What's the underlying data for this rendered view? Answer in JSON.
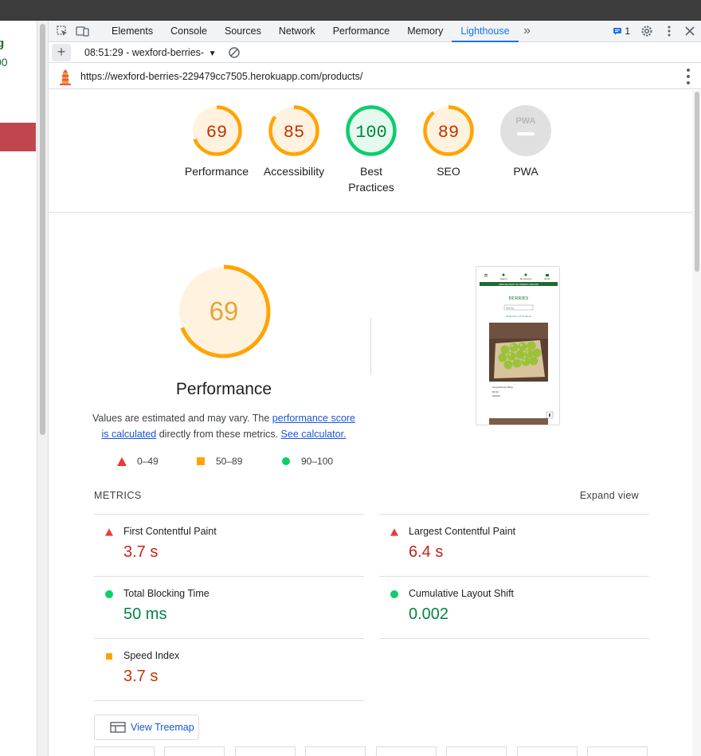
{
  "left_page": {
    "fragment_1": "g",
    "fragment_2": "00"
  },
  "tabs": [
    {
      "label": "Elements"
    },
    {
      "label": "Console"
    },
    {
      "label": "Sources"
    },
    {
      "label": "Network"
    },
    {
      "label": "Performance"
    },
    {
      "label": "Memory"
    },
    {
      "label": "Lighthouse",
      "active": true
    }
  ],
  "issues_count": "1",
  "report": {
    "selector": "08:51:29 - wexford-berries-",
    "url": "https://wexford-berries-229479cc7505.herokuapp.com/products/"
  },
  "scores": [
    {
      "label": "Performance",
      "score": "69",
      "fraction": 0.69,
      "rating": "average"
    },
    {
      "label": "Accessibility",
      "score": "85",
      "fraction": 0.85,
      "rating": "average"
    },
    {
      "label_line1": "Best",
      "label_line2": "Practices",
      "score": "100",
      "fraction": 1.0,
      "rating": "pass"
    },
    {
      "label": "SEO",
      "score": "89",
      "fraction": 0.89,
      "rating": "average"
    },
    {
      "label": "PWA",
      "badge": "PWA"
    }
  ],
  "performance": {
    "score": "69",
    "fraction": 0.69,
    "title": "Performance",
    "desc_1": "Values are estimated and may vary. The ",
    "link_1": "performance score",
    "link_1b": "is calculated",
    "desc_2": " directly from these metrics. ",
    "link_2": "See calculator."
  },
  "legend": [
    {
      "range": "0–49",
      "color": "#eb3b33",
      "shape": "triangle"
    },
    {
      "range": "50–89",
      "color": "#ffa400",
      "shape": "square"
    },
    {
      "range": "90–100",
      "color": "#0cce6b",
      "shape": "circle"
    }
  ],
  "metrics_section": {
    "title": "METRICS",
    "expand": "Expand view"
  },
  "metrics": [
    {
      "name": "First Contentful Paint",
      "value": "3.7 s",
      "rating": "fail"
    },
    {
      "name": "Largest Contentful Paint",
      "value": "6.4 s",
      "rating": "fail"
    },
    {
      "name": "Total Blocking Time",
      "value": "50 ms",
      "rating": "pass"
    },
    {
      "name": "Cumulative Layout Shift",
      "value": "0.002",
      "rating": "pass"
    },
    {
      "name": "Speed Index",
      "value": "3.7 s",
      "rating": "average"
    }
  ],
  "treemap_label": "View Treemap",
  "page_preview": {
    "banner": "FREE DELIVERY ON ORDERS OVER €50",
    "heading": "BERRIES",
    "product_name": "Gooseberries 500g",
    "price": "€5.99",
    "nav_items": [
      "Search",
      "My Account",
      "€0.00"
    ],
    "sort_label": "Sort by...",
    "filter_text": "All Berries | 16 Products"
  },
  "colors": {
    "fail": "#c5221f",
    "average": "#c33300",
    "pass": "#018642",
    "accent": "#1a73e8",
    "gauge_average": "#ffa400",
    "gauge_pass": "#0cce6b"
  }
}
